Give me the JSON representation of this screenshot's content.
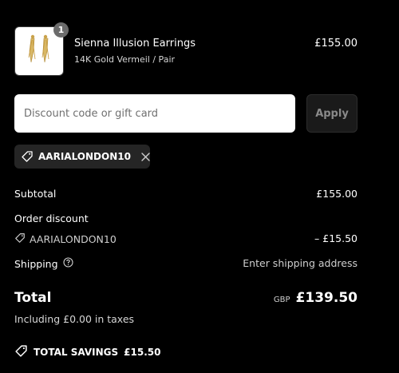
{
  "product": {
    "name": "Sienna Illusion Earrings",
    "variant": "14K Gold Vermeil / Pair",
    "price": "£155.00",
    "quantity": "1"
  },
  "discount": {
    "placeholder": "Discount code or gift card",
    "value": "",
    "apply_label": "Apply",
    "applied_code": "AARIALONDON10"
  },
  "summary": {
    "subtotal_label": "Subtotal",
    "subtotal_value": "£155.00",
    "order_discount_label": "Order discount",
    "discount_code": "AARIALONDON10",
    "discount_value": "– £15.50",
    "shipping_label": "Shipping",
    "shipping_value": "Enter shipping address",
    "total_label": "Total",
    "total_currency": "GBP",
    "total_value": "£139.50",
    "tax_note": "Including £0.00 in taxes",
    "savings_label": "TOTAL SAVINGS",
    "savings_value": "£15.50"
  },
  "icons": {
    "tag": "tag-icon",
    "close": "close-icon",
    "help": "help-circle-icon"
  },
  "colors": {
    "background": "#000000",
    "text": "#ffffff",
    "muted_text": "#cfcfcf",
    "input_background": "#ffffff",
    "chip_background": "#252525",
    "apply_button_background": "#1a1a1a"
  }
}
